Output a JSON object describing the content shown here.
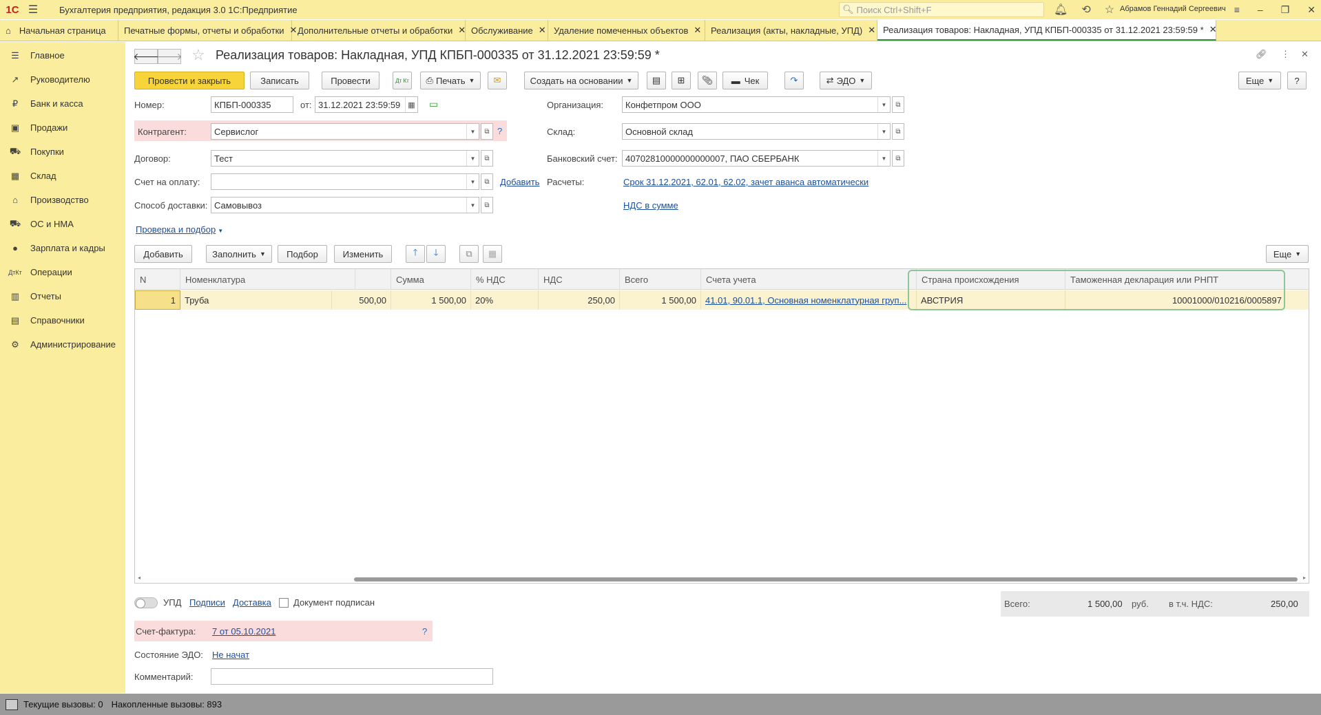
{
  "app": {
    "title": "Бухгалтерия предприятия, редакция 3.0 1С:Предприятие",
    "logo": "1С",
    "search_placeholder": "Поиск Ctrl+Shift+F",
    "user": "Абрамов Геннадий Сергеевич"
  },
  "tabs": [
    {
      "label": "Начальная страница"
    },
    {
      "label": "Печатные формы, отчеты и обработки"
    },
    {
      "label": "Дополнительные отчеты и обработки"
    },
    {
      "label": "Обслуживание"
    },
    {
      "label": "Удаление помеченных объектов"
    },
    {
      "label": "Реализация (акты, накладные, УПД)"
    },
    {
      "label": "Реализация товаров: Накладная, УПД КПБП-000335 от 31.12.2021 23:59:59 *"
    }
  ],
  "sidebar": {
    "items": [
      {
        "label": "Главное",
        "icon": "menu-icon"
      },
      {
        "label": "Руководителю",
        "icon": "trend-icon"
      },
      {
        "label": "Банк и касса",
        "icon": "ruble-icon"
      },
      {
        "label": "Продажи",
        "icon": "bag-icon"
      },
      {
        "label": "Покупки",
        "icon": "cart-icon"
      },
      {
        "label": "Склад",
        "icon": "warehouse-icon"
      },
      {
        "label": "Производство",
        "icon": "factory-icon"
      },
      {
        "label": "ОС и НМА",
        "icon": "truck-icon"
      },
      {
        "label": "Зарплата и кадры",
        "icon": "person-icon"
      },
      {
        "label": "Операции",
        "icon": "dtkt-icon"
      },
      {
        "label": "Отчеты",
        "icon": "chart-icon"
      },
      {
        "label": "Справочники",
        "icon": "book-icon"
      },
      {
        "label": "Администрирование",
        "icon": "gear-icon"
      }
    ]
  },
  "form": {
    "title": "Реализация товаров: Накладная, УПД КПБП-000335 от 31.12.2021 23:59:59 *",
    "toolbar": {
      "post_close": "Провести и закрыть",
      "save": "Записать",
      "post": "Провести",
      "dtkt": "Дт Кт",
      "print": "Печать",
      "create_based": "Создать на основании",
      "receipt": "Чек",
      "edo": "ЭДО",
      "more": "Еще",
      "help": "?"
    },
    "fields": {
      "number_label": "Номер:",
      "number": "КПБП-000335",
      "date_label": "от:",
      "date": "31.12.2021 23:59:59",
      "org_label": "Организация:",
      "org": "Конфетпром ООО",
      "counterparty_label": "Контрагент:",
      "counterparty": "Сервислог",
      "warehouse_label": "Склад:",
      "warehouse": "Основной склад",
      "contract_label": "Договор:",
      "contract": "Тест",
      "bank_label": "Банковский счет:",
      "bank": "40702810000000000007, ПАО СБЕРБАНК",
      "invoice_label": "Счет на оплату:",
      "invoice": "",
      "add_link": "Добавить",
      "settlements_label": "Расчеты:",
      "settlements": "Срок 31.12.2021, 62.01, 62.02, зачет аванса автоматически",
      "delivery_label": "Способ доставки:",
      "delivery": "Самовывоз",
      "vat_link": "НДС в сумме",
      "check_link": "Проверка и подбор"
    },
    "table_toolbar": {
      "add": "Добавить",
      "fill": "Заполнить",
      "pick": "Подбор",
      "change": "Изменить",
      "more": "Еще"
    },
    "table": {
      "columns": [
        "N",
        "Номенклатура",
        "",
        "Сумма",
        "% НДС",
        "НДС",
        "Всего",
        "Счета учета",
        "Страна происхождения",
        "Таможенная декларация или РНПТ"
      ],
      "rows": [
        [
          "1",
          "Труба",
          "500,00",
          "1 500,00",
          "20%",
          "250,00",
          "1 500,00",
          "41.01, 90.01.1, Основная номенклатурная груп...",
          "АВСТРИЯ",
          "10001000/010216/0005897"
        ]
      ]
    },
    "footer": {
      "upd_label": "УПД",
      "signatures_link": "Подписи",
      "delivery_link": "Доставка",
      "signed_label": "Документ подписан",
      "total_label": "Всего:",
      "total": "1 500,00",
      "currency": "руб.",
      "vat_incl_label": "в т.ч. НДС:",
      "vat": "250,00",
      "invoice_label": "Счет-фактура:",
      "invoice_link": "7 от 05.10.2021",
      "edo_label": "Состояние ЭДО:",
      "edo_link": "Не начат",
      "comment_label": "Комментарий:",
      "comment": ""
    }
  },
  "statusbar": {
    "current": "Текущие вызовы: 0",
    "accumulated": "Накопленные вызовы: 893"
  }
}
